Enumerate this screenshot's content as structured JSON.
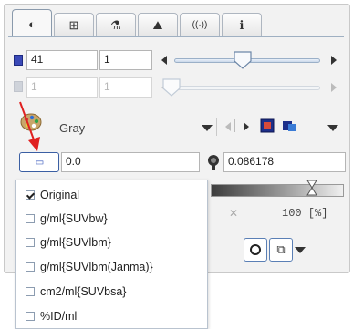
{
  "tabs": [
    {
      "name": "tab-contrast",
      "glyph": "◐",
      "active": true
    },
    {
      "name": "tab-grid",
      "glyph": "⊞",
      "active": false
    },
    {
      "name": "tab-tools",
      "glyph": "⚗",
      "active": false
    },
    {
      "name": "tab-chart",
      "glyph": "⛰",
      "active": false
    },
    {
      "name": "tab-signal",
      "glyph": "((·))",
      "active": false
    },
    {
      "name": "tab-info",
      "glyph": "ℹ",
      "active": false
    }
  ],
  "slice_row": {
    "value1": "41",
    "value2": "1",
    "slider_fraction": 0.55
  },
  "frame_row": {
    "value1": "1",
    "value2": "1",
    "slider_fraction": 0.03
  },
  "colormap": {
    "label": "Gray"
  },
  "window": {
    "min_value": "0.0",
    "max_value": "0.086178"
  },
  "ramp": {
    "label": "100 [%]"
  },
  "units_menu": {
    "options": [
      {
        "label": "Original",
        "checked": true
      },
      {
        "label": "g/ml{SUVbw}",
        "checked": false
      },
      {
        "label": "g/ml{SUVlbm}",
        "checked": false
      },
      {
        "label": "g/ml{SUVlbm(Janma)}",
        "checked": false
      },
      {
        "label": "cm2/ml{SUVbsa}",
        "checked": false
      },
      {
        "label": "%ID/ml",
        "checked": false
      }
    ]
  },
  "colors": {
    "accent_blue": "#2b4db8",
    "arrow_red": "#e02020"
  }
}
